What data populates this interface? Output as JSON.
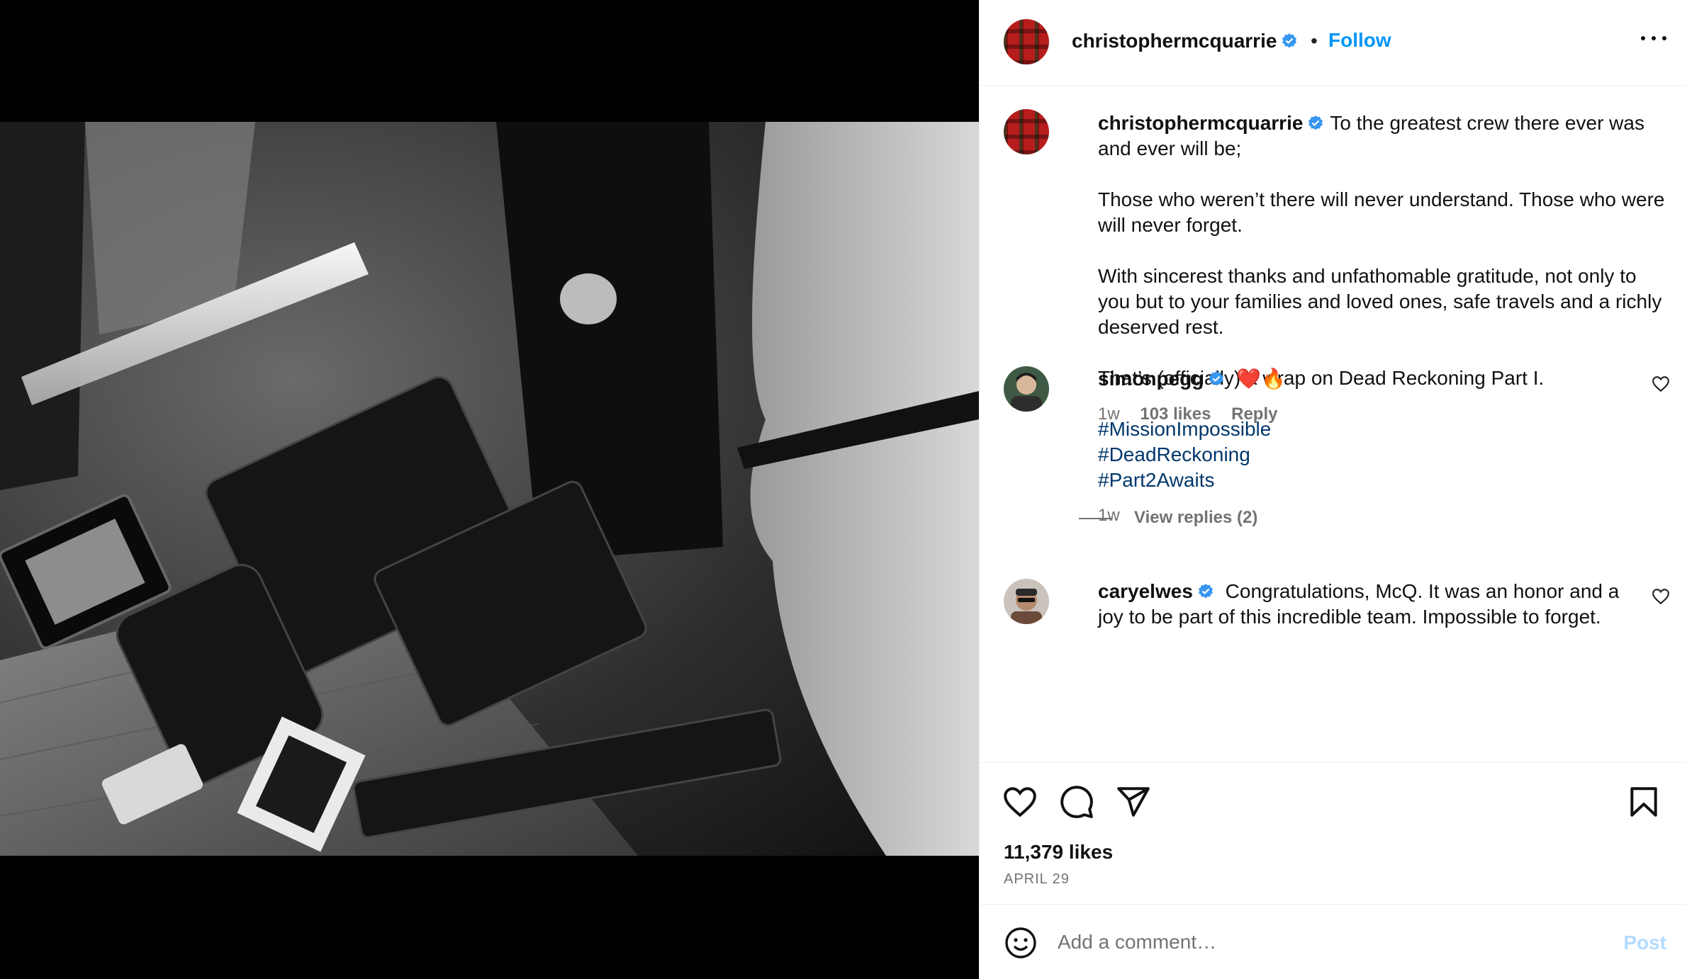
{
  "post": {
    "author": "christophermcquarrie",
    "follow_label": "Follow",
    "separator": "•",
    "caption_lines": [
      "To the greatest crew there ever was and ever will be;",
      "Those who weren’t there will never understand. Those who were will never forget.",
      "With sincerest thanks and unfathomable gratitude, not only to you but to your families and loved ones, safe travels and a richly deserved rest.",
      "That’s (officially) a wrap on Dead Reckoning Part I."
    ],
    "hashtags": [
      "#MissionImpossible",
      "#DeadReckoning",
      "#Part2Awaits"
    ],
    "caption_time": "1w",
    "likes": "11,379 likes",
    "date": "APRIL 29"
  },
  "comments": [
    {
      "user": "simonpegg",
      "text": "❤️🔥",
      "time": "1w",
      "likes": "103 likes",
      "reply_label": "Reply",
      "view_replies": "View replies (2)"
    },
    {
      "user": "caryelwes",
      "text": "Congratulations, McQ. It was an honor and a joy to be part of this incredible team. Impossible to forget."
    }
  ],
  "composer": {
    "placeholder": "Add a comment…",
    "post_label": "Post"
  },
  "icons": {
    "verified": "verified-badge-icon",
    "more": "more-options-icon",
    "like": "heart-icon",
    "comment": "comment-bubble-icon",
    "share": "paper-plane-icon",
    "save": "bookmark-icon",
    "emoji": "emoji-smiley-icon"
  },
  "colors": {
    "accent": "#0095f6",
    "hashtag": "#00376b",
    "secondary_text": "#737373",
    "verified": "#3897f0",
    "post_disabled": "#b3dbff"
  }
}
